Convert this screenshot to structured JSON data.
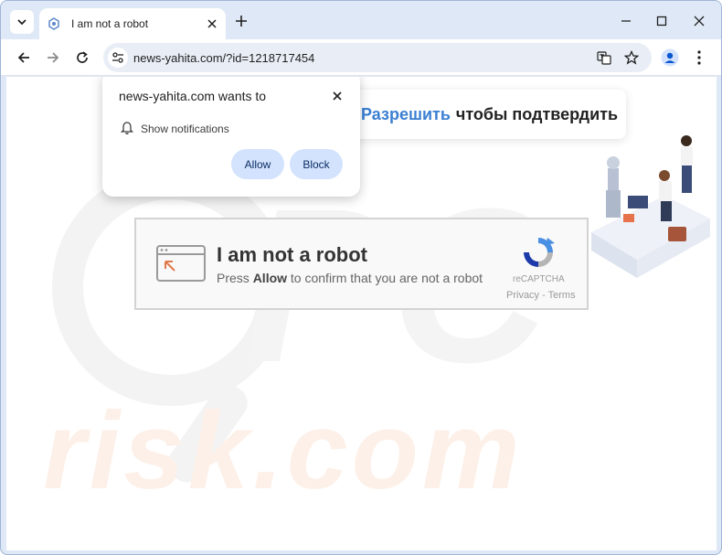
{
  "browser": {
    "tab": {
      "title": "I am not a robot"
    },
    "address_bar": {
      "url": "news-yahita.com/?id=1218717454"
    }
  },
  "permission_popup": {
    "title": "news-yahita.com wants to",
    "permission_label": "Show notifications",
    "allow_label": "Allow",
    "block_label": "Block"
  },
  "page": {
    "banner": {
      "accent_text": "Разрешить",
      "rest_text": "чтобы подтвердить"
    },
    "captcha": {
      "title": "I am not a robot",
      "subtitle_pre": "Press ",
      "subtitle_bold": "Allow",
      "subtitle_post": " to confirm that you are not a robot",
      "brand": "reCAPTCHA",
      "links": "Privacy - Terms"
    },
    "watermark": {
      "text": "risk.com",
      "letters": "PC"
    }
  },
  "colors": {
    "accent": "#3b7fd2",
    "chrome_frame": "#dfe8f6",
    "button_bg": "#d3e3fd"
  },
  "icons": [
    "tab-search-icon",
    "favicon-icon",
    "close-icon",
    "new-tab-icon",
    "minimize-icon",
    "maximize-icon",
    "back-arrow-icon",
    "forward-arrow-icon",
    "reload-icon",
    "site-info-icon",
    "translate-icon",
    "star-icon",
    "profile-icon",
    "menu-icon",
    "bell-icon",
    "browser-window-icon",
    "recaptcha-logo-icon"
  ]
}
